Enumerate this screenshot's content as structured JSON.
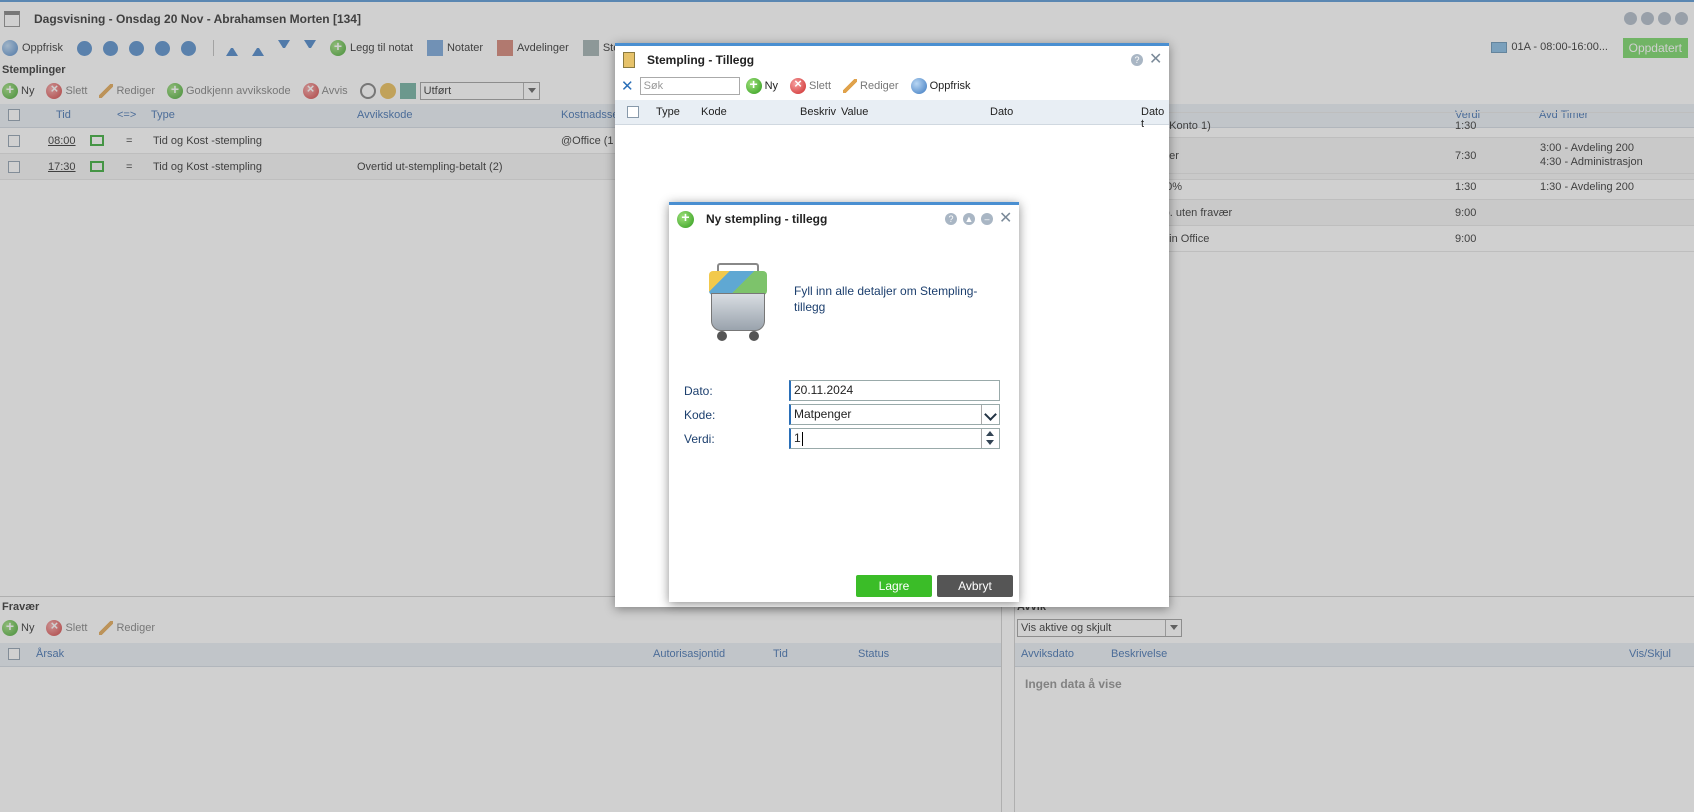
{
  "app": {
    "title": "Dagsvisning - Onsdag 20 Nov - Abrahamsen Morten [134]",
    "toolbar": {
      "refresh": "Oppfrisk",
      "add_note": "Legg til notat",
      "notes": "Notater",
      "departments": "Avdelinger",
      "stamping": "Stempling"
    },
    "schedule": "01A - 08:00-16:00...",
    "updated_badge": "Oppdatert"
  },
  "stamps": {
    "title": "Stemplinger",
    "actions": {
      "new": "Ny",
      "delete": "Slett",
      "edit": "Rediger",
      "approve": "Godkjenn avvikskode",
      "reject": "Avvis",
      "status_select": "Utført"
    },
    "columns": [
      "Tid",
      "<=>",
      "Type",
      "Avvikskode",
      "Kostnadsse"
    ],
    "rows": [
      {
        "time": "08:00",
        "dir": "=",
        "type": "Tid og Kost -stempling",
        "code": "",
        "cost": "@Office (1"
      },
      {
        "time": "17:30",
        "dir": "=",
        "type": "Tid og Kost -stempling",
        "code": "Overtid ut-stempling-betalt (2)",
        "cost": ""
      }
    ]
  },
  "summary": {
    "columns": [
      "Verdi",
      "Avd Timer"
    ],
    "rows": [
      {
        "label": "l (Konto 1)",
        "value": "1:30",
        "avd": ""
      },
      {
        "label": "mer",
        "value": "7:30",
        "avd": "3:00 - Avdeling 200",
        "avd2": "4:30 - Administrasjon"
      },
      {
        "label": "50%",
        "value": "1:30",
        "avd": "1:30 - Avdeling 200"
      },
      {
        "label": "rb. uten fravær",
        "value": "9:00",
        "avd": ""
      },
      {
        "label": "g in Office",
        "value": "9:00",
        "avd": ""
      }
    ]
  },
  "absence": {
    "title": "Fravær",
    "actions": {
      "new": "Ny",
      "delete": "Slett",
      "edit": "Rediger"
    },
    "columns": [
      "Årsak",
      "Autorisasjontid",
      "Tid",
      "Status"
    ]
  },
  "deviation": {
    "title": "Avvik",
    "filter": "Vis aktive og skjult",
    "columns": [
      "Avviksdato",
      "Beskrivelse",
      "Vis/Skjul"
    ],
    "empty": "Ingen data å vise"
  },
  "dialog_stamping": {
    "title": "Stempling - Tillegg",
    "search_placeholder": "Søk",
    "actions": {
      "new": "Ny",
      "delete": "Slett",
      "edit": "Rediger",
      "refresh": "Oppfrisk"
    },
    "columns": [
      "Type",
      "Kode",
      "Beskriv",
      "Value",
      "Dato",
      "Dato t"
    ]
  },
  "dialog_new": {
    "title": "Ny stempling - tillegg",
    "info": "Fyll inn alle detaljer om Stempling-tillegg",
    "fields": {
      "date_label": "Dato:",
      "date_value": "20.11.2024",
      "code_label": "Kode:",
      "code_value": "Matpenger",
      "value_label": "Verdi:",
      "value_value": "1"
    },
    "save": "Lagre",
    "cancel": "Avbryt"
  }
}
